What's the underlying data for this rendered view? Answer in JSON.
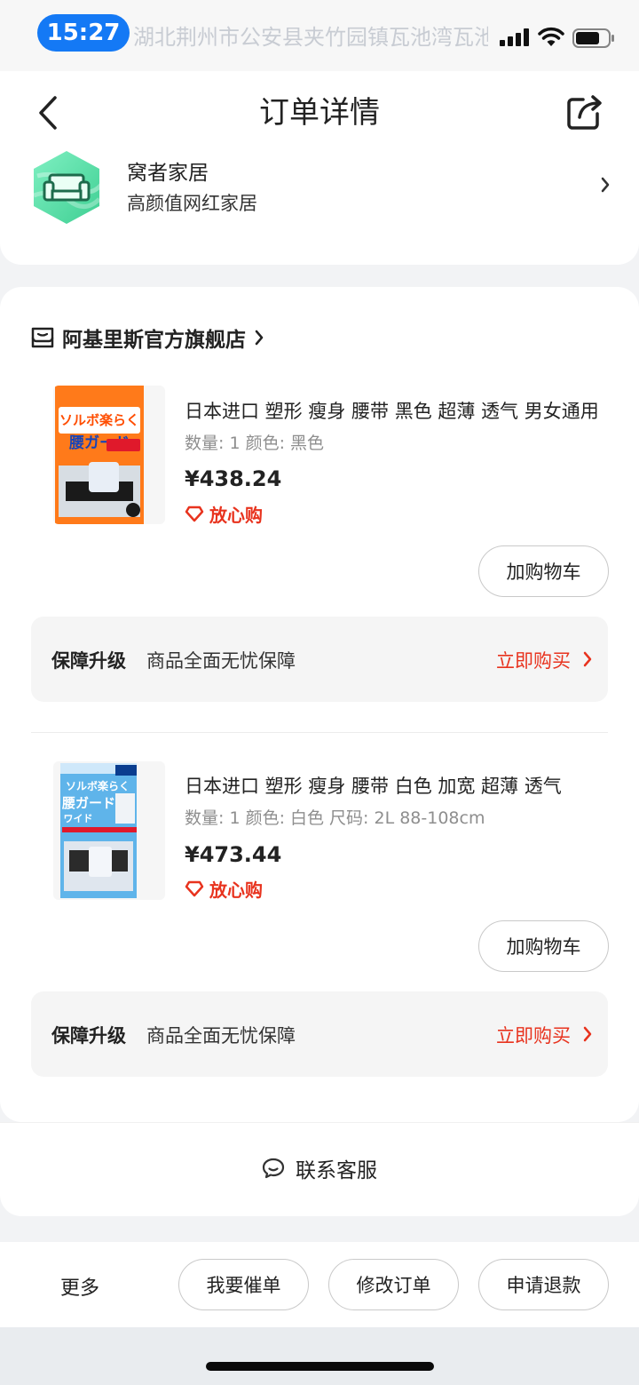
{
  "status_bar": {
    "time": "15:27",
    "ghost_text": "湖北荆州市公安县夹竹园镇瓦池湾瓦池"
  },
  "header": {
    "title": "订单详情",
    "brand_name": "窝者家居",
    "brand_slogan": "高颜值网红家居"
  },
  "shop": {
    "name": "阿基里斯官方旗舰店"
  },
  "products": [
    {
      "title": "日本进口 塑形 瘦身 腰带 黑色 超薄 透气 男女通用",
      "spec": "数量: 1  颜色: 黑色",
      "price": "¥438.24",
      "badge": "放心购",
      "cart_label": "加购物车",
      "image_jp_line1": "ソルボ楽らく",
      "image_jp_line2": "腰ガード",
      "protect": {
        "title": "保障升级",
        "desc": "商品全面无忧保障",
        "cta": "立即购买"
      }
    },
    {
      "title": "日本进口 塑形 瘦身 腰带 白色 加宽 超薄 透气",
      "spec": "数量: 1  颜色: 白色  尺码: 2L 88-108cm",
      "price": "¥473.44",
      "badge": "放心购",
      "cart_label": "加购物车",
      "image_jp_line1": "ソルボ楽らく",
      "image_jp_line2": "腰ガード",
      "image_jp_line3": "ワイド",
      "protect": {
        "title": "保障升级",
        "desc": "商品全面无忧保障",
        "cta": "立即购买"
      }
    }
  ],
  "service": {
    "label": "联系客服"
  },
  "actions": {
    "more": "更多",
    "urge": "我要催单",
    "modify": "修改订单",
    "refund": "申请退款"
  },
  "colors": {
    "accent_red": "#e8331e",
    "status_pill": "#1479f5",
    "logo_green": "#4fd9a0"
  },
  "icons": [
    "back-icon",
    "share-icon",
    "sofa-icon",
    "shop-icon",
    "heart-shield-icon",
    "chat-icon",
    "chevron-right-icon",
    "signal-icon",
    "wifi-icon",
    "battery-icon"
  ]
}
